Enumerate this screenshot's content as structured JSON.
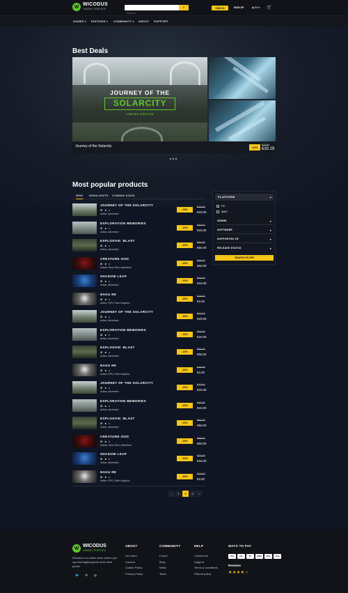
{
  "header": {
    "logo_title": "WICODUS",
    "logo_subtitle": "GAMING TEMPLATE",
    "search_placeholder": "Search",
    "sign_in": "SIGN IN",
    "sign_up": "SIGN UP",
    "language": "EN",
    "nav": [
      "GAMES ▾",
      "EDITIONS ▾",
      "COMMUNITY ▾",
      "ABOUT",
      "SUPPORT"
    ]
  },
  "best_deals": {
    "heading": "Best Deals",
    "banner_line1": "JOURNEY OF THE",
    "banner_line2": "SOLARCITY",
    "banner_line3": "LIMITED EDITION",
    "name": "Journey of the Solarcity",
    "discount": "-10%",
    "old_price": "€33.99",
    "new_price": "€30.29"
  },
  "popular": {
    "heading": "Most popular products",
    "tabs": [
      "NEW",
      "HIGHLIGHTS",
      "COMING SOON"
    ],
    "products": [
      {
        "name": "JOURNEY OF THE SOLARCITY",
        "genre": "Action, Adventure",
        "discount": "-15%",
        "old": "€27.00",
        "new": "€23.00"
      },
      {
        "name": "EXPLORATION MEMORIES",
        "genre": "Action, Adventure",
        "discount": "-10%",
        "old": "€34.00",
        "new": "€24.00"
      },
      {
        "name": "EXPLOSIVE: BLAST",
        "genre": "Action, Adventure",
        "discount": "-10%",
        "old": "€92.00",
        "new": "€84.00"
      },
      {
        "name": "CREATURE 2020",
        "genre": "Drama, Story Rich, Adventure",
        "discount": "-20%",
        "old": "€98.00",
        "new": "€84.00"
      },
      {
        "name": "SHADOW LEAP",
        "genre": "Action, Adventure",
        "discount": "-10%",
        "old": "€72.00",
        "new": "€24.00"
      },
      {
        "name": "NAKU RE",
        "genre": "Action, RPG, Pixel Graphics",
        "discount": "-20%",
        "old": "€10.00",
        "new": "€3.20"
      },
      {
        "name": "JOURNEY OF THE SOLARCITY",
        "genre": "Action, Adventure",
        "discount": "-15%",
        "old": "€27.00",
        "new": "€23.00"
      },
      {
        "name": "EXPLORATION MEMORIES",
        "genre": "Action, Adventure",
        "discount": "-10%",
        "old": "€34.00",
        "new": "€24.00"
      },
      {
        "name": "EXPLOSIVE: BLAST",
        "genre": "Action, Adventure",
        "discount": "-10%",
        "old": "€92.00",
        "new": "€84.00"
      },
      {
        "name": "NAKU RE",
        "genre": "Action, RPG, Pixel Graphics",
        "discount": "-20%",
        "old": "€10.00",
        "new": "€3.20"
      },
      {
        "name": "JOURNEY OF THE SOLARCITY",
        "genre": "Action, Adventure",
        "discount": "-15%",
        "old": "€27.00",
        "new": "€23.00"
      },
      {
        "name": "EXPLORATION MEMORIES",
        "genre": "Action, Adventure",
        "discount": "-10%",
        "old": "€34.00",
        "new": "€24.00"
      },
      {
        "name": "EXPLOSIVE: BLAST",
        "genre": "Action, Adventure",
        "discount": "-10%",
        "old": "€92.00",
        "new": "€84.00"
      },
      {
        "name": "CREATURE 2020",
        "genre": "Drama, Story Rich, Adventure",
        "discount": "-20%",
        "old": "€98.00",
        "new": "€84.00"
      },
      {
        "name": "SHADOW LEAP",
        "genre": "Action, Adventure",
        "discount": "-10%",
        "old": "€72.00",
        "new": "€24.00"
      },
      {
        "name": "NAKU RE",
        "genre": "Action, RPG, Pixel Graphics",
        "discount": "-20%",
        "old": "€10.00",
        "new": "€3.20"
      }
    ],
    "pages": [
      "‹",
      "1",
      "2",
      "3",
      "›"
    ],
    "active_page": "2"
  },
  "filter": {
    "platform": "PLATFORM",
    "options": [
      "PC",
      "MAC"
    ],
    "sections": [
      "GENRE",
      "SOFTWARE",
      "SUPPORTED VR",
      "RELEASE STATUS"
    ],
    "button": "SEARCH FILTER"
  },
  "footer": {
    "logo_title": "WICODUS",
    "logo_subtitle": "GAMING TEMPLATE",
    "description": "Wicodus is a online store where you can find digital goods at the best prices.",
    "columns": [
      {
        "title": "ABOUT",
        "links": [
          "Our team",
          "Careers",
          "Cookie Policy",
          "Privacy Policy"
        ]
      },
      {
        "title": "COMMUNITY",
        "links": [
          "Forum",
          "Blog",
          "News",
          "Team"
        ]
      },
      {
        "title": "HELP",
        "links": [
          "Contact Us",
          "Support",
          "Terms & conditions",
          "Refund policy"
        ]
      }
    ],
    "pay_title": "WAYS TO PAY",
    "pay_methods": [
      "VISA",
      "MC",
      "PP",
      "AMEX",
      "GPay",
      "APay"
    ],
    "reviews_label": "Reviews",
    "rating": 4
  },
  "colors": {
    "accent": "#f5c518",
    "brand_green": "#5ec82a",
    "background": "#0f1523"
  }
}
